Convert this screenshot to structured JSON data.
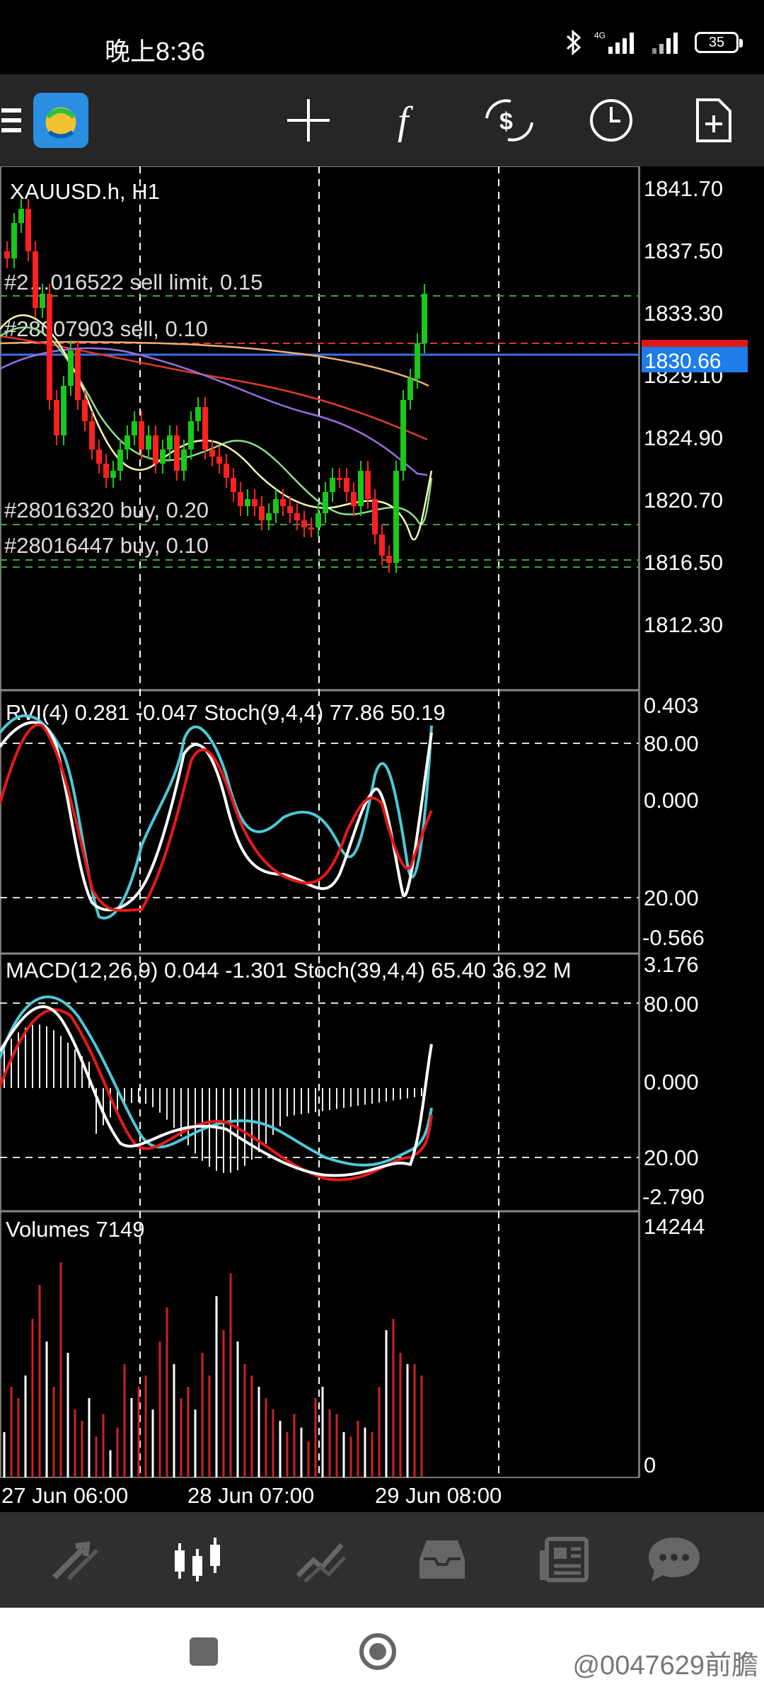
{
  "status": {
    "time": "晚上8:36",
    "network": "4G",
    "battery": "35"
  },
  "toolbar": {
    "menu_icon": "hamburger-icon",
    "app_icon": "metatrader-app-icon",
    "tools": [
      "crosshair-icon",
      "function-icon",
      "symbol-icon",
      "timeframe-icon",
      "new-order-icon"
    ]
  },
  "main_chart": {
    "title": "XAUUSD.h, H1",
    "price_labels": [
      "1841.70",
      "1837.50",
      "1833.30",
      "1829.10",
      "1824.90",
      "1820.70",
      "1816.50",
      "1812.30"
    ],
    "current_price": "1830.66",
    "order_lines": [
      {
        "label": "#2…016522 sell limit, 0.15"
      },
      {
        "label": "#28007903 sell, 0.10"
      },
      {
        "label": "#28016320 buy, 0.20"
      },
      {
        "label": "#28016447 buy, 0.10"
      }
    ]
  },
  "rvi_panel": {
    "title": "RVI(4) 0.281 -0.047 Stoch(9,4,4) 77.86 50.19",
    "labels": [
      "0.403",
      "80.00",
      "0.000",
      "20.00",
      "-0.566"
    ]
  },
  "macd_panel": {
    "title": "MACD(12,26,9) 0.044 -1.301 Stoch(39,4,4) 65.40 36.92 M",
    "labels": [
      "3.176",
      "80.00",
      "0.000",
      "20.00",
      "-2.790"
    ]
  },
  "volume_panel": {
    "title": "Volumes 7149",
    "labels": [
      "14244",
      "0"
    ]
  },
  "time_axis": [
    "27 Jun 06:00",
    "28 Jun 07:00",
    "29 Jun 08:00"
  ],
  "bottom_nav": [
    {
      "name": "quotes-icon"
    },
    {
      "name": "chart-icon",
      "active": true
    },
    {
      "name": "trade-icon"
    },
    {
      "name": "history-icon"
    },
    {
      "name": "news-icon"
    },
    {
      "name": "messages-icon"
    }
  ],
  "system_nav": {
    "watermark": "@0047629前膽"
  },
  "colors": {
    "bull": "#19c819",
    "bear": "#ff2020",
    "price_tag": "#1e7de8",
    "grid": "#ffffff"
  }
}
